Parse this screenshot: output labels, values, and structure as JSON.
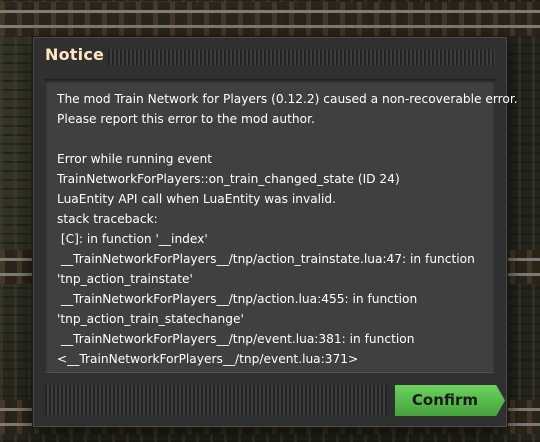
{
  "dialog": {
    "title": "Notice",
    "message_lines": [
      "The mod Train Network for Players (0.12.2) caused a non-recoverable error.",
      "Please report this error to the mod author.",
      "",
      "Error while running event",
      "TrainNetworkForPlayers::on_train_changed_state (ID 24)",
      "LuaEntity API call when LuaEntity was invalid.",
      "stack traceback:",
      " [C]: in function '__index'",
      " __TrainNetworkForPlayers__/tnp/action_trainstate.lua:47: in function",
      "'tnp_action_trainstate'",
      " __TrainNetworkForPlayers__/tnp/action.lua:455: in function",
      "'tnp_action_train_statechange'",
      " __TrainNetworkForPlayers__/tnp/event.lua:381: in function",
      "<__TrainNetworkForPlayers__/tnp/event.lua:371>"
    ],
    "confirm_label": "Confirm"
  },
  "colors": {
    "title": "#ffe6c0",
    "confirm_button": "#5cbf4f",
    "panel": "#313031",
    "content": "#414041"
  }
}
